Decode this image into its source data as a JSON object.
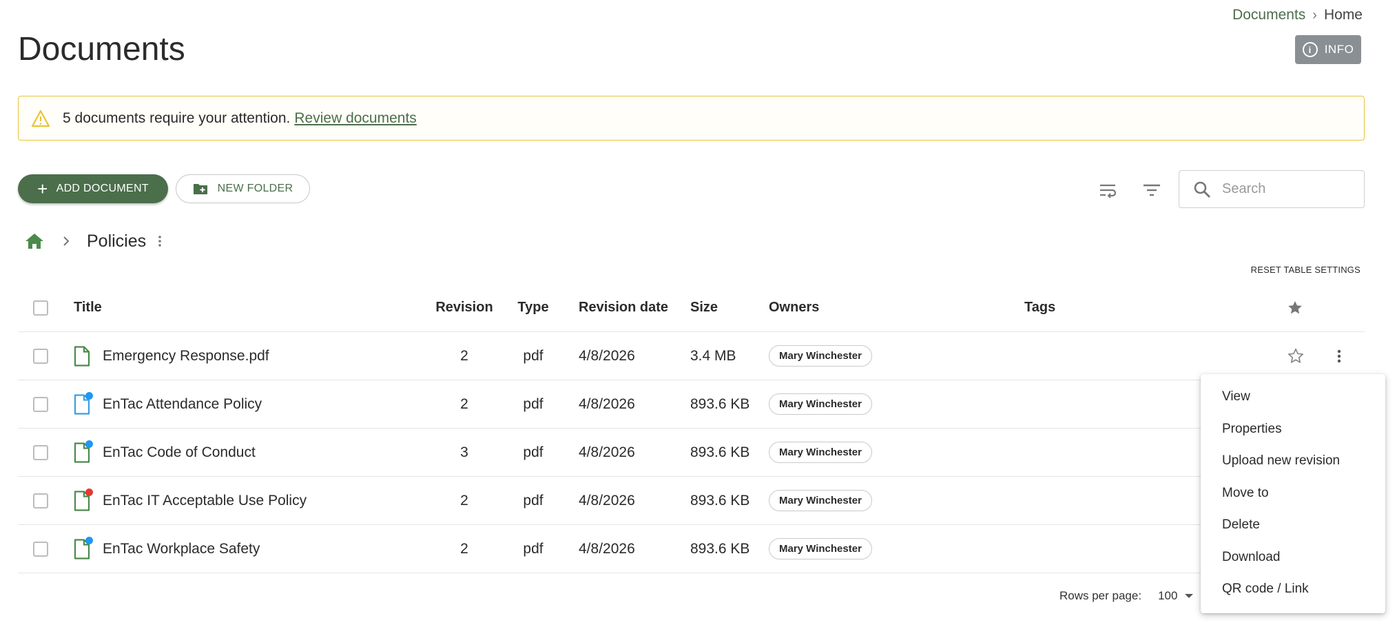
{
  "breadcrumb": {
    "parent": "Documents",
    "current": "Home",
    "separator": "›"
  },
  "page_title": "Documents",
  "info_button": {
    "label": "INFO",
    "icon": "info-icon"
  },
  "alert": {
    "message": "5 documents require your attention.",
    "link": "Review documents",
    "icon": "warning-icon",
    "color": "#e8c33b"
  },
  "toolbar": {
    "add_label": "ADD DOCUMENT",
    "folder_label": "NEW FOLDER",
    "search_placeholder": "Search"
  },
  "folder": {
    "name": "Policies",
    "home_icon": "home-icon"
  },
  "reset_label": "RESET TABLE SETTINGS",
  "table": {
    "headers": {
      "title": "Title",
      "revision": "Revision",
      "type": "Type",
      "date": "Revision date",
      "size": "Size",
      "owners": "Owners",
      "tags": "Tags"
    },
    "rows": [
      {
        "title": "Emergency Response.pdf",
        "revision": "2",
        "type": "pdf",
        "date": "4/8/2026",
        "size": "3.4 MB",
        "owner": "Mary Winchester",
        "icon_color": "#4b8a4b",
        "dot": ""
      },
      {
        "title": "EnTac Attendance Policy",
        "revision": "2",
        "type": "pdf",
        "date": "4/8/2026",
        "size": "893.6 KB",
        "owner": "Mary Winchester",
        "icon_color": "#3aa0e0",
        "dot": "#2196f3"
      },
      {
        "title": "EnTac Code of Conduct",
        "revision": "3",
        "type": "pdf",
        "date": "4/8/2026",
        "size": "893.6 KB",
        "owner": "Mary Winchester",
        "icon_color": "#4b8a4b",
        "dot": "#2196f3"
      },
      {
        "title": "EnTac IT Acceptable Use Policy",
        "revision": "2",
        "type": "pdf",
        "date": "4/8/2026",
        "size": "893.6 KB",
        "owner": "Mary Winchester",
        "icon_color": "#4b8a4b",
        "dot": "#e53935"
      },
      {
        "title": "EnTac Workplace Safety",
        "revision": "2",
        "type": "pdf",
        "date": "4/8/2026",
        "size": "893.6 KB",
        "owner": "Mary Winchester",
        "icon_color": "#4b8a4b",
        "dot": "#2196f3"
      }
    ]
  },
  "pagination": {
    "label": "Rows per page:",
    "value": "100"
  },
  "context_menu": {
    "items": [
      "View",
      "Properties",
      "Upload new revision",
      "Move to",
      "Delete",
      "Download",
      "QR code / Link"
    ]
  },
  "colors": {
    "brand": "#4b6e4b",
    "warning": "#e8c33b"
  }
}
